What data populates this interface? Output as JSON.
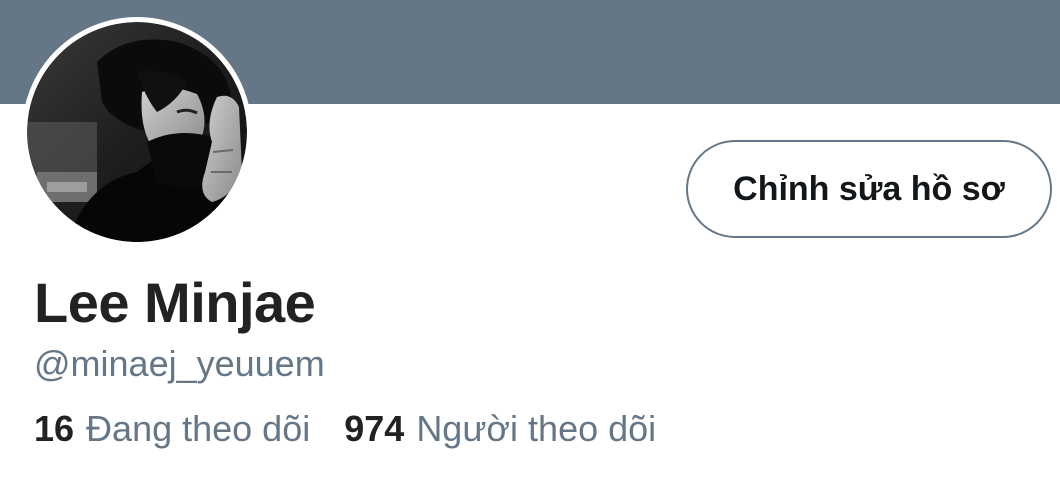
{
  "profile": {
    "display_name": "Lee Minjae",
    "handle": "@minaej_yeuuem",
    "edit_button_label": "Chỉnh sửa hồ sơ",
    "following": {
      "count": "16",
      "label": "Đang theo dõi"
    },
    "followers": {
      "count": "974",
      "label": "Người theo dõi"
    }
  },
  "colors": {
    "banner": "#657786",
    "secondary_text": "#657786",
    "primary_text": "#222222",
    "background": "#ffffff"
  }
}
